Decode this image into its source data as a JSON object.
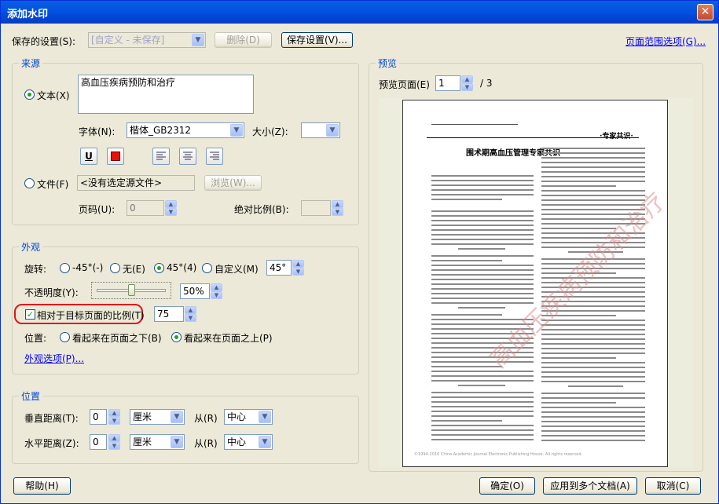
{
  "window": {
    "title": "添加水印",
    "close_label": "✕"
  },
  "top": {
    "saved_settings_label": "保存的设置(S):",
    "saved_settings_value": "[自定义 - 未保存]",
    "delete_label": "删除(D)",
    "save_settings_label": "保存设置(V)...",
    "page_range_label": "页面范围选项(G)..."
  },
  "source": {
    "group_title": "来源",
    "text_radio_label": "文本(X)",
    "text_value": "高血压疾病预防和治疗",
    "font_label": "字体(N):",
    "font_value": "楷体_GB2312",
    "size_label": "大小(Z):",
    "size_value": "",
    "file_radio_label": "文件(F)",
    "file_value": "<没有选定源文件>",
    "browse_label": "浏览(W)...",
    "page_label": "页码(U):",
    "page_value": "0",
    "abs_scale_label": "绝对比例(B):",
    "abs_scale_value": "",
    "underline_glyph": "U",
    "accent_color": "#e8110f"
  },
  "appearance": {
    "group_title": "外观",
    "rotation_label": "旋转:",
    "rot_minus45": "-45°(-)",
    "rot_none": "无(E)",
    "rot_45": "45°(4)",
    "rot_custom": "自定义(M)",
    "rot_custom_value": "45°",
    "opacity_label": "不透明度(Y):",
    "opacity_value": "50%",
    "opacity_fraction": 0.5,
    "relative_scale_label": "相对于目标页面的比例(T)",
    "relative_scale_value": "75",
    "position_label": "位置:",
    "behind_label": "看起来在页面之下(B)",
    "front_label": "看起来在页面之上(P)",
    "appearance_options_label": "外观选项(P)..."
  },
  "position": {
    "group_title": "位置",
    "vertical_label": "垂直距离(T):",
    "vertical_value": "0",
    "vertical_unit": "厘米",
    "vertical_from_label": "从(R)",
    "vertical_from_value": "中心",
    "horizontal_label": "水平距离(Z):",
    "horizontal_value": "0",
    "horizontal_unit": "厘米",
    "horizontal_from_label": "从(R)",
    "horizontal_from_value": "中心"
  },
  "preview": {
    "group_title": "预览",
    "page_label": "预览页面(E)",
    "page_value": "1",
    "page_total": "/ 3",
    "doc_title": "围术期高血压管理专家共识",
    "doc_header_right": "·专家共识·",
    "watermark_text": "高血压疾病预防和治疗",
    "footer_text": "©1994-2016 China Academic Journal Electronic Publishing House. All rights reserved."
  },
  "footer": {
    "help_label": "帮助(H)",
    "ok_label": "确定(O)",
    "apply_multi_label": "应用到多个文档(A)",
    "cancel_label": "取消(C)"
  },
  "annotation_color": "#e0141e"
}
